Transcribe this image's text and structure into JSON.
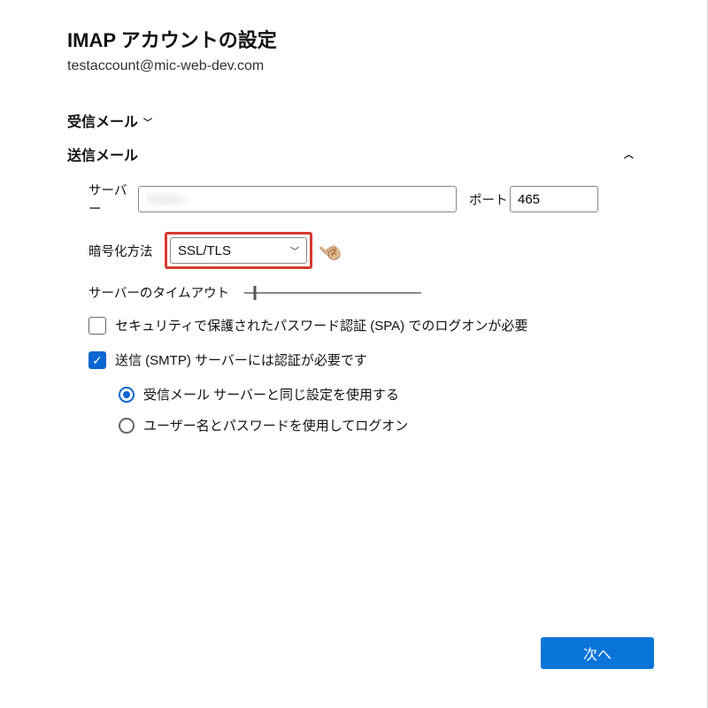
{
  "title": "IMAP アカウントの設定",
  "account_email": "testaccount@mic-web-dev.com",
  "incoming": {
    "heading": "受信メール"
  },
  "outgoing": {
    "heading": "送信メール",
    "server_label": "サーバー",
    "server_value": "hidden",
    "port_label": "ポート",
    "port_value": "465",
    "encryption_label": "暗号化方法",
    "encryption_value": "SSL/TLS",
    "timeout_label": "サーバーのタイムアウト",
    "spa_label": "セキュリティで保護されたパスワード認証 (SPA) でのログオンが必要",
    "spa_checked": false,
    "smtp_auth_label": "送信 (SMTP) サーバーには認証が必要です",
    "smtp_auth_checked": true,
    "radio_same_label": "受信メール サーバーと同じ設定を使用する",
    "radio_userpass_label": "ユーザー名とパスワードを使用してログオン",
    "radio_selected": "same"
  },
  "buttons": {
    "next": "次へ"
  },
  "icons": {
    "pointer": "☝🏼"
  }
}
